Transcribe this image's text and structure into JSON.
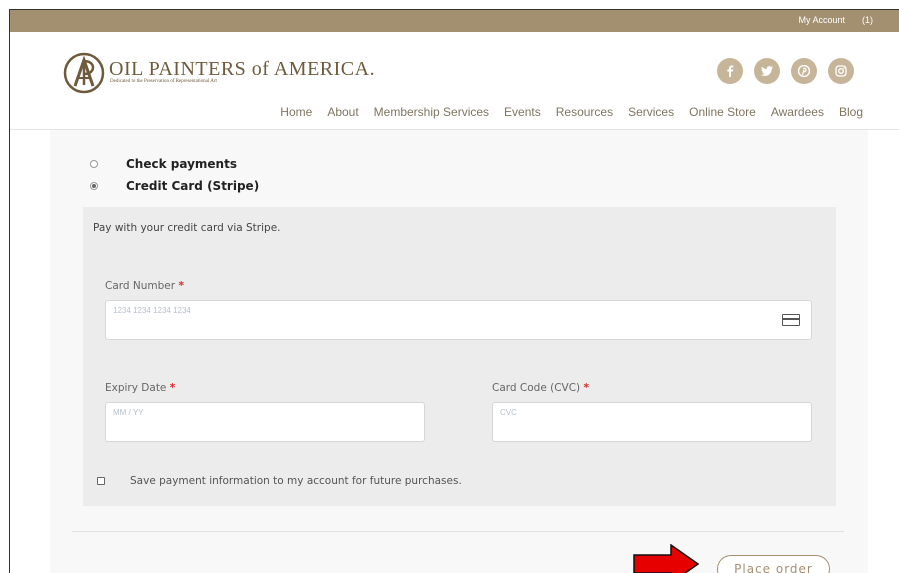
{
  "topbar": {
    "account_label": "My Account",
    "cart_label": "(1)"
  },
  "brand": {
    "name": "OIL PAINTERS of AMERICA.",
    "tagline": "Dedicated to the Preservation of Representational Art"
  },
  "social": [
    "facebook-icon",
    "twitter-icon",
    "pinterest-icon",
    "instagram-icon"
  ],
  "nav": [
    "Home",
    "About",
    "Membership Services",
    "Events",
    "Resources",
    "Services",
    "Online Store",
    "Awardees",
    "Blog"
  ],
  "payment": {
    "methods": [
      {
        "label": "Check payments",
        "selected": false
      },
      {
        "label": "Credit Card (Stripe)",
        "selected": true
      }
    ],
    "stripe_description": "Pay with your credit card via Stripe.",
    "card_number": {
      "label": "Card Number",
      "required_mark": "*",
      "placeholder": "1234 1234 1234 1234"
    },
    "expiry": {
      "label": "Expiry Date",
      "required_mark": "*",
      "placeholder": "MM / YY"
    },
    "cvc": {
      "label": "Card Code (CVC)",
      "required_mark": "*",
      "placeholder": "CVC"
    },
    "save_info_label": "Save payment information to my account for future purchases."
  },
  "place_order_label": "Place order",
  "colors": {
    "brand": "#a39071",
    "arrow": "#e60000",
    "required": "#dd2222"
  }
}
